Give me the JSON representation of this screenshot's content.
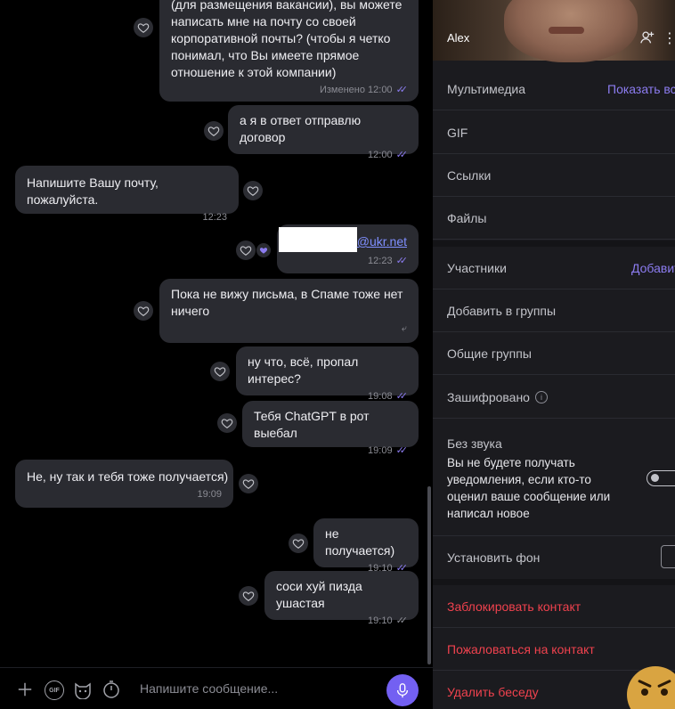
{
  "messages": [
    {
      "side": "out",
      "text": "(для размещения вакансии), вы можете написать мне на почту со своей корпоративной почты? (чтобы я четко понимал, что Вы имеете прямое отношение к этой компании)",
      "time": "Изменено 12:00",
      "status": "read"
    },
    {
      "side": "out",
      "text": "а я в ответ отправлю договор",
      "time": "12:00",
      "status": "read"
    },
    {
      "side": "in",
      "text": "Напишите Вашу почту, пожалуйста.",
      "time": "12:23"
    },
    {
      "side": "out",
      "text": "@ukr.net",
      "time": "12:23",
      "status": "read"
    },
    {
      "side": "out",
      "text": "Пока не вижу письма, в Спаме тоже нет ничего",
      "time": "",
      "status": "sent"
    },
    {
      "side": "out",
      "text": "ну что, всё, пропал интерес?",
      "time": "19:08",
      "status": "read"
    },
    {
      "side": "out",
      "text": "Тебя ChatGPT в рот выебал",
      "time": "19:09",
      "status": "read"
    },
    {
      "side": "in",
      "text": "Не, ну так и тебя тоже получается)",
      "time": "19:09"
    },
    {
      "side": "out",
      "text": "не получается)",
      "time": "19:10",
      "status": "read"
    },
    {
      "side": "out",
      "text": "соси хуй пизда ушастая",
      "time": "19:10",
      "status": "delivered"
    }
  ],
  "composer": {
    "placeholder": "Напишите сообщение...",
    "gif_label": "GIF"
  },
  "info": {
    "contact_name": "Alex",
    "media_label": "Мультимедиа",
    "media_action": "Показать все",
    "gif_label": "GIF",
    "links_label": "Ссылки",
    "files_label": "Файлы",
    "participants_label": "Участники",
    "participants_action": "Добавить",
    "add_to_groups": "Добавить в группы",
    "common_groups": "Общие группы",
    "encrypted": "Зашифровано",
    "mute_title": "Без звука",
    "mute_desc": "Вы не будете получать уведомления, если кто-то оценил ваше сообщение или написал новое",
    "set_background": "Установить фон",
    "block_contact": "Заблокировать контакт",
    "report_contact": "Пожаловаться на контакт",
    "delete_chat": "Удалить беседу"
  },
  "colors": {
    "accent": "#7360f2",
    "bubble": "#2a2b31",
    "danger": "#f0424e",
    "read_ticks": "#8c7cf0"
  }
}
